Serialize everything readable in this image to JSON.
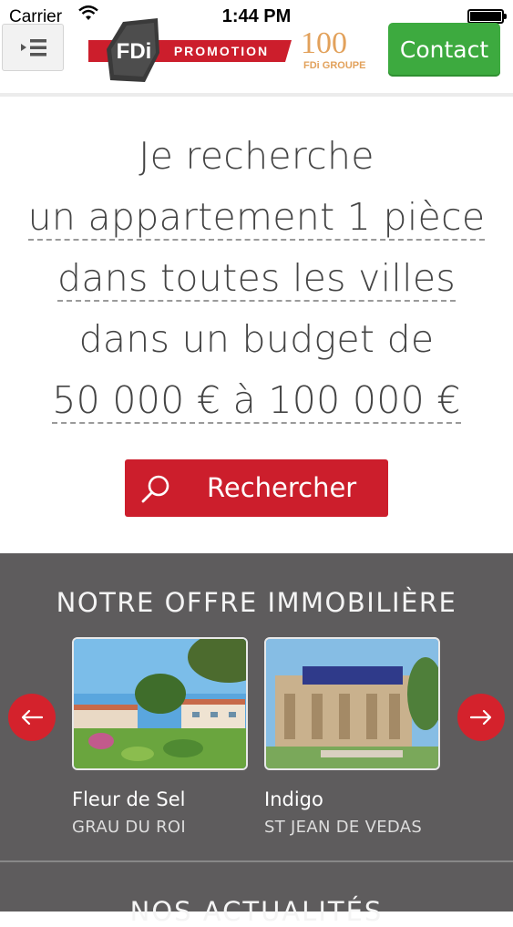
{
  "status_bar": {
    "carrier": "Carrier",
    "time": "1:44 PM"
  },
  "header": {
    "logo_fdi": "FDi",
    "logo_promotion": "PROMOTION",
    "logo_100": "100",
    "logo_groupe": "FDi GROUPE",
    "contact_label": "Contact"
  },
  "search": {
    "line1": "Je recherche",
    "property_type": "un appartement 1 pièce",
    "location": "dans toutes les villes",
    "budget_prefix": "dans un budget de",
    "budget_range": "50 000 € à 100 000 €",
    "button_label": "Rechercher"
  },
  "offer": {
    "title": "NOTRE OFFRE IMMOBILIÈRE",
    "cards": [
      {
        "name": "Fleur de Sel",
        "city": "GRAU DU ROI"
      },
      {
        "name": "Indigo",
        "city": "ST JEAN DE VEDAS"
      }
    ]
  },
  "news": {
    "title": "NOS ACTUALITÉS"
  },
  "colors": {
    "accent_red": "#cc1e2c",
    "contact_green": "#3daa3f",
    "offer_background": "#5e5c5d"
  }
}
